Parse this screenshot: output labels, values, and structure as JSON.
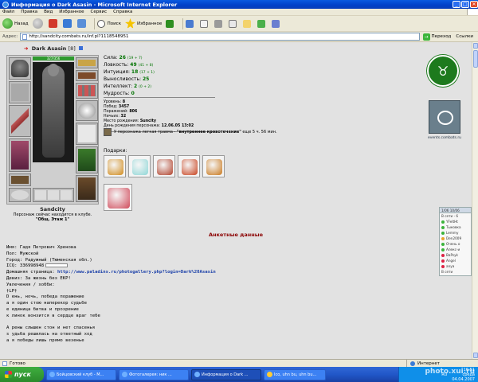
{
  "window": {
    "title": "Информация о Dark Asasin - Microsoft Internet Explorer",
    "buttons": {
      "minimize": "_",
      "maximize": "□",
      "close": "✕"
    }
  },
  "menu": [
    "Файл",
    "Правка",
    "Вид",
    "Избранное",
    "Сервис",
    "Справка"
  ],
  "toolbar": {
    "back": "Назад",
    "search": "Поиск",
    "favorites": "Избранное"
  },
  "address": {
    "label": "Адрес:",
    "url": "http://sandcity.combats.ru/inf.pl?1118548951",
    "go": "Переход",
    "links": "Ссылки"
  },
  "character": {
    "name": "Dark Asasin",
    "level": "[8]",
    "hp": "327/356",
    "town": "Sandcity",
    "status_line": "Персонаж сейчас находится в клубе.",
    "location": "\"Общ. Этаж 1\""
  },
  "stats": [
    {
      "label": "Сила:",
      "value": "26",
      "bonus": "(19 + 7)"
    },
    {
      "label": "Ловкость:",
      "value": "49",
      "bonus": "(41 + 8)"
    },
    {
      "label": "Интуиция:",
      "value": "18",
      "bonus": "(17 + 1)"
    },
    {
      "label": "Выносливость:",
      "value": "25",
      "bonus": ""
    },
    {
      "label": "Интеллект:",
      "value": "2",
      "bonus": "(0 + 2)"
    },
    {
      "label": "Мудрость:",
      "value": "0",
      "bonus": ""
    }
  ],
  "info": [
    {
      "label": "Уровень:",
      "value": "8"
    },
    {
      "label": "Побед:",
      "value": "3457"
    },
    {
      "label": "Поражений:",
      "value": "806"
    },
    {
      "label": "Ничьих:",
      "value": "32"
    },
    {
      "label": "Место рождения:",
      "value": "Suncity"
    },
    {
      "label": "День рождения персонажа:",
      "value": "12.06.05 13:02"
    }
  ],
  "trauma": {
    "prefix": "У персонажа легкая травма -",
    "name": "\"внутреннее кровотечение\"",
    "suffix": "еще 5 ч. 56 мин."
  },
  "gifts_label": "Подарки:",
  "gifts": [
    {
      "color": "#d08a1a"
    },
    {
      "color": "#8fd6d6"
    },
    {
      "color": "#b0402a"
    },
    {
      "color": "#c8421e"
    },
    {
      "color": "#c9781c"
    },
    {
      "color": "#d04a5a"
    }
  ],
  "events_link": "events.combats.ru",
  "widget": {
    "header": "1/06 10/06",
    "rows": [
      "В сети - 6",
      "YFeltHt",
      "Тыковка",
      "Lemmy",
      "Den2009",
      "Очень о",
      "Алекс-и",
      "BaPsyk",
      "Angel",
      "anya",
      "В сети"
    ]
  },
  "profile": {
    "section_title": "Анкетные данные",
    "lines": [
      "Имя: Гадя Петрович Хренова",
      "Пол: Мужской",
      "Город: Радужный (Тюменская обл.)",
      "ICQ: 336998948"
    ],
    "homepage_label": "Домашняя страница:",
    "homepage_url": "http://www.paladins.ru/photogallery.php?login=Dark%20Asasin",
    "motto": "Девиз: За жизнь без ЕКР!",
    "hobbies": "Увлечения / хобби:",
    "poem": [
      "†LP†",
      "D ень, ночь, победа поражение",
      "а я один стою наперекор судьбе",
      "е единица битва и прозрение",
      "к линок вонзится в сердце враг тебе",
      "",
      "A рены слышен стон и нет спасенья",
      "s удьба решилась на ответный ход",
      "а я победы лишь прямо везенье"
    ]
  },
  "statusbar": {
    "text": "Готово",
    "zone": "Интернет"
  },
  "taskbar": {
    "start": "пуск",
    "items": [
      "Бойцовский клуб - M...",
      "Фотогалерея: ник ...",
      "Информация о Dark ...",
      "Ico, uhn bu, uhn bu..."
    ],
    "lang": "RU",
    "time": "16:51",
    "day": "среда",
    "date": "04.04.2007"
  },
  "watermark": "photo.xui.ru"
}
